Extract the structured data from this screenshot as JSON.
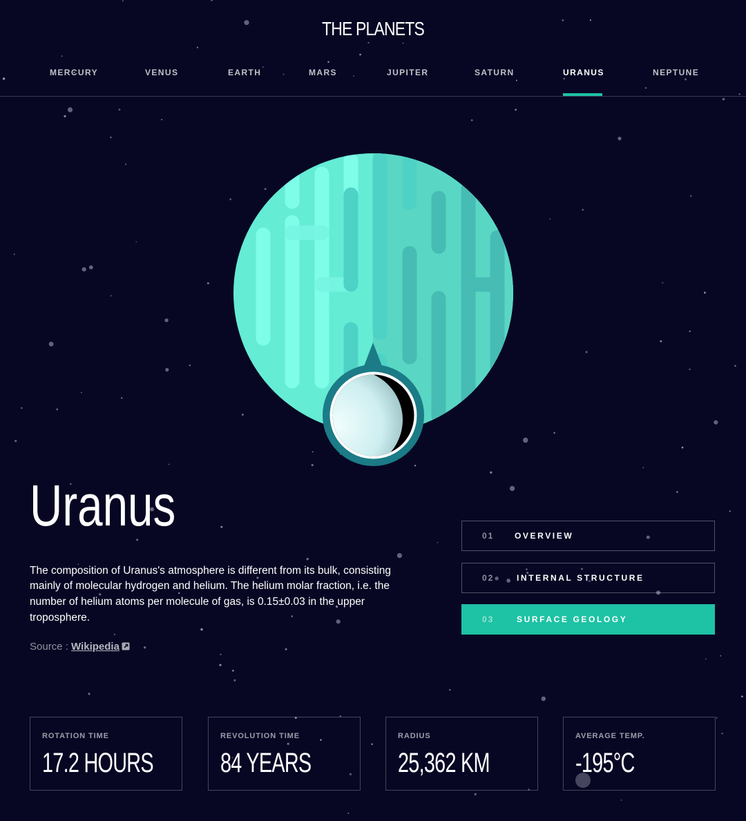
{
  "brand": "THE PLANETS",
  "nav": [
    "MERCURY",
    "VENUS",
    "EARTH",
    "MARS",
    "JUPITER",
    "SATURN",
    "URANUS",
    "NEPTUNE"
  ],
  "nav_active": "URANUS",
  "planet": {
    "name": "Uranus",
    "description": "The composition of Uranus's atmosphere is different from its bulk, consisting mainly of molecular hydrogen and helium. The helium molar fraction, i.e. the number of helium atoms per molecule of gas, is 0.15±0.03 in the upper troposphere.",
    "source_prefix": "Source : ",
    "source_link": "Wikipedia"
  },
  "tabs": [
    {
      "num": "01",
      "label": "OVERVIEW"
    },
    {
      "num": "02",
      "label": "INTERNAL STRUCTURE"
    },
    {
      "num": "03",
      "label": "SURFACE GEOLOGY"
    }
  ],
  "tab_active": "03",
  "stats": [
    {
      "label": "ROTATION TIME",
      "value": "17.2 HOURS"
    },
    {
      "label": "REVOLUTION TIME",
      "value": "84 YEARS"
    },
    {
      "label": "RADIUS",
      "value": "25,362 KM"
    },
    {
      "label": "AVERAGE TEMP.",
      "value": "-195°C"
    }
  ],
  "colors": {
    "background": "#070724",
    "accent": "#1ec2a4",
    "planet_light": "#65f0d5",
    "planet_dark": "#44b8b0",
    "geology_ring": "#1b7b86"
  }
}
